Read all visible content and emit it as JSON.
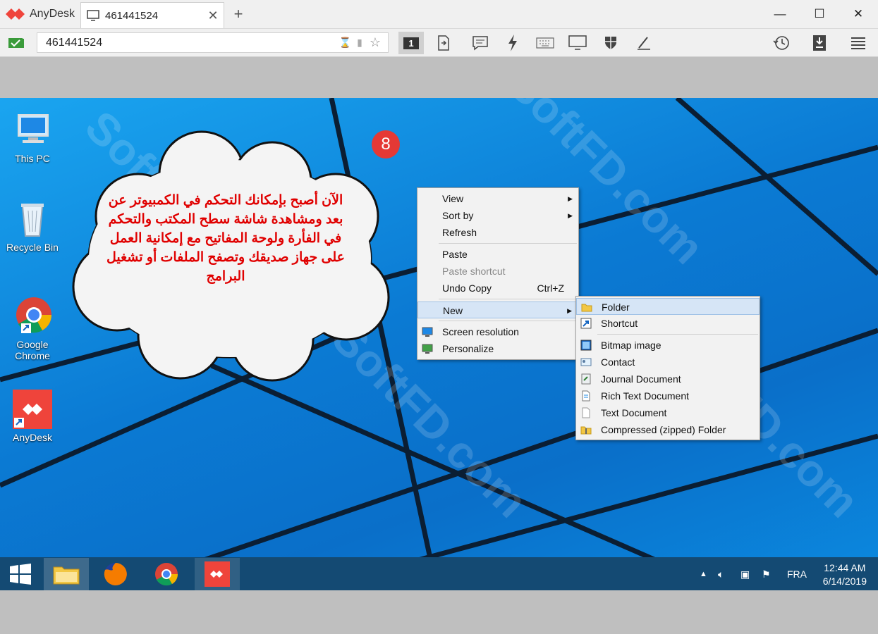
{
  "app": {
    "name": "AnyDesk"
  },
  "tab": {
    "title": "461441524"
  },
  "address": {
    "value": "461441524"
  },
  "toolbar": {
    "display_number": "1"
  },
  "desktop": {
    "icons": [
      {
        "label": "This PC"
      },
      {
        "label": "Recycle Bin"
      },
      {
        "label": "Google Chrome"
      },
      {
        "label": "AnyDesk"
      }
    ],
    "step_badge": "8",
    "cloud_text": "الآن أصبح بإمكانك التحكم في الكمبيوتر عن بعد ومشاهدة شاشة سطح المكتب والتحكم في الفأرة ولوحة المفاتيح مع إمكانية العمل على جهاز صديقك وتصفح الملفات أو تشغيل البرامج",
    "watermark": "SoftFD.com"
  },
  "context_menu": {
    "view": "View",
    "sort_by": "Sort by",
    "refresh": "Refresh",
    "paste": "Paste",
    "paste_shortcut": "Paste shortcut",
    "undo_copy": "Undo Copy",
    "undo_shortcut": "Ctrl+Z",
    "new": "New",
    "screen_resolution": "Screen resolution",
    "personalize": "Personalize"
  },
  "new_submenu": {
    "folder": "Folder",
    "shortcut": "Shortcut",
    "bitmap_image": "Bitmap image",
    "contact": "Contact",
    "journal_document": "Journal Document",
    "rich_text_document": "Rich Text Document",
    "text_document": "Text Document",
    "compressed_folder": "Compressed (zipped) Folder"
  },
  "taskbar": {
    "language": "FRA",
    "time": "12:44 AM",
    "date": "6/14/2019"
  },
  "colors": {
    "anydesk_red": "#ef443b",
    "taskbar": "#144a73",
    "cloud_text": "#e00000",
    "menu_highlight": "#d6e5f6"
  }
}
